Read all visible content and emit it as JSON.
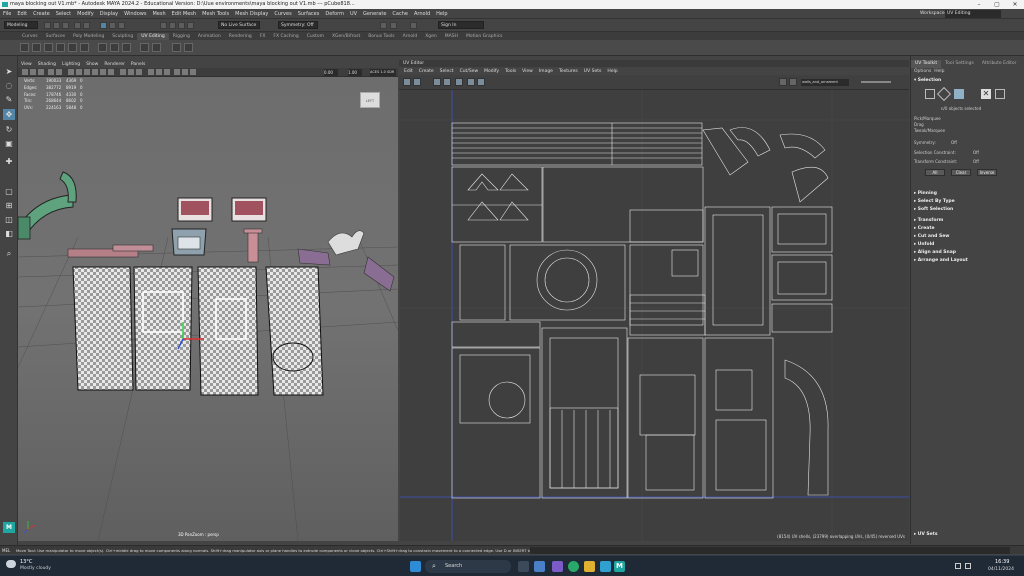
{
  "window": {
    "title": "maya blocking out V1.mb* - Autodesk MAYA 2024.2 - Educational Version: D:\\Uue environments\\maya blocking out V1.mb  ---  pCube818..."
  },
  "menubar": {
    "items": [
      "File",
      "Edit",
      "Create",
      "Select",
      "Modify",
      "Display",
      "Windows",
      "Mesh",
      "Edit Mesh",
      "Mesh Tools",
      "Mesh Display",
      "Curves",
      "Surfaces",
      "Deform",
      "UV",
      "Generate",
      "Cache",
      "Arnold",
      "Help"
    ],
    "workspace_label": "Workspace :",
    "workspace_value": "UV Editing"
  },
  "statusline": {
    "mode": "Modeling",
    "live_surface": "No Live Surface",
    "symmetry": "Symmetry: Off",
    "signin": "Sign In"
  },
  "shelf": {
    "tabs": [
      "Curves",
      "Surfaces",
      "Poly Modeling",
      "Sculpting",
      "UV Editing",
      "Rigging",
      "Animation",
      "Rendering",
      "FX",
      "FX Caching",
      "Custom",
      "XGen/Bifrost",
      "Bonus Tools",
      "Arnold",
      "Xgen",
      "MASH",
      "Motion Graphics"
    ],
    "active": "UV Editing"
  },
  "viewport": {
    "menu": [
      "View",
      "Shading",
      "Lighting",
      "Show",
      "Renderer",
      "Panels"
    ],
    "hud": [
      {
        "label": "Verts:",
        "v1": "190033",
        "v2": "4369",
        "v3": "0"
      },
      {
        "label": "Edges:",
        "v1": "382772",
        "v2": "8919",
        "v3": "0"
      },
      {
        "label": "Faces:",
        "v1": "178746",
        "v2": "4330",
        "v3": "0"
      },
      {
        "label": "Tris:",
        "v1": "268644",
        "v2": "8602",
        "v3": "0"
      },
      {
        "label": "UVs:",
        "v1": "224163",
        "v2": "5848",
        "v3": "0"
      }
    ],
    "camera": "3D PanZoom : persp",
    "cube_label": "LEFT",
    "field_a": "0.00",
    "field_b": "1.00",
    "color_space": "ACES 1.0 SDR"
  },
  "uv_editor": {
    "title": "UV Editor",
    "menu": [
      "Edit",
      "Create",
      "Select",
      "Cut/Sew",
      "Modify",
      "Tools",
      "View",
      "Image",
      "Textures",
      "UV Sets",
      "Help"
    ],
    "texture": "walls_and_ornament",
    "status": "(8154) UV shells, (23799) overlapping UVs, (0/45) reversed UVs"
  },
  "uv_toolkit": {
    "tabs": [
      "UV Toolkit",
      "Tool Settings",
      "Attribute Editor"
    ],
    "sub": [
      "Options",
      "Help"
    ],
    "selection_header": "Selection",
    "selected_count": "n/0 objects selected",
    "pick_options": [
      "Pick/Marquee",
      "Drag",
      "Tweak/Marquee"
    ],
    "symmetry_label": "Symmetry:",
    "symmetry_value": "Off",
    "constraint_label": "Selection Constraint:",
    "constraint_value": "Off",
    "transform_label": "Transform Constraint:",
    "transform_value": "Off",
    "buttons": [
      "All",
      "Clear",
      "Inverse"
    ],
    "sections": [
      "Pinning",
      "Select By Type",
      "Soft Selection",
      "Transform",
      "Create",
      "Cut and Sew",
      "Unfold",
      "Align and Snap",
      "Arrange and Layout"
    ],
    "uv_sets": "UV Sets"
  },
  "command_line": {
    "mel": "MEL",
    "message": "Move Tool: Use manipulator to move object(s). Ctrl+middle drag to move components along normals. Shift+drag manipulator axis or plane handles to extrude components or clone objects. Ctrl+Shift+drag to constrain movement to a connected edge. Use D or INSERT to change th"
  },
  "taskbar": {
    "weather_temp": "13°C",
    "weather_desc": "Mostly cloudy",
    "search": "Search",
    "time": "16:39",
    "date": "04/11/2024"
  },
  "colors": {
    "selected_tool": "#5285a6",
    "uv_lines": "#e6e6e6",
    "taskbar": "#1f2a36"
  }
}
